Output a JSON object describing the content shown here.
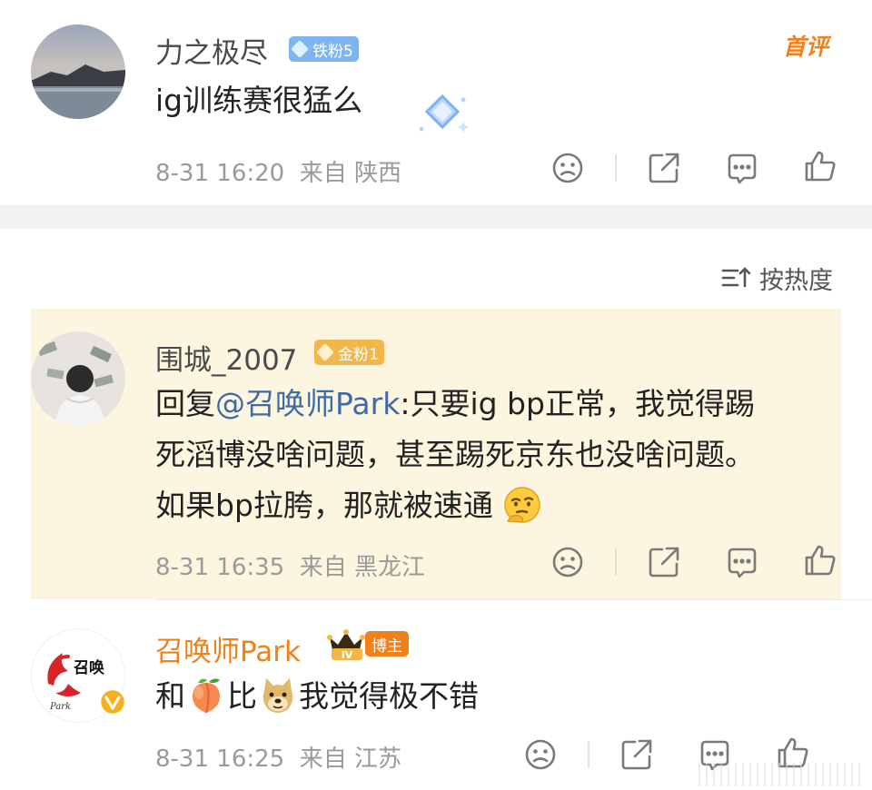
{
  "comment1": {
    "username": "力之极尽",
    "fan_badge": "铁粉5",
    "text": "ig训练赛很猛么",
    "time": "8-31 16:20",
    "location": "来自 陕西",
    "top_label": "首评"
  },
  "sort_bar": {
    "label": "按热度"
  },
  "comment2": {
    "username": "围城_2007",
    "fan_badge": "金粉1",
    "reply_prefix": "回复",
    "mention": "@召唤师Park",
    "line1": ":只要ig bp正常，我觉得踢",
    "line2": "死滔博没啥问题，甚至踢死京东也没啥问题。",
    "line3": "如果bp拉胯，那就被速通",
    "time": "8-31 16:35",
    "location": "来自 黑龙江"
  },
  "comment3": {
    "username": "召唤师Park",
    "level_badge": "IV",
    "role_badge": "博主",
    "text_a": "和",
    "text_b": "比",
    "text_c": "我觉得极不错",
    "time": "8-31 16:25",
    "location": "来自 江苏",
    "avatar_text": "召唤",
    "avatar_sub": "Park"
  },
  "colors": {
    "accent_orange": "#f0801a",
    "highlight_bg": "#fcf6e0",
    "iron_badge": "#7fb5ef",
    "gold_badge": "#f2b64a",
    "mention_blue": "#3d6ba8"
  },
  "icons": [
    "sad-face-icon",
    "share-icon",
    "comment-icon",
    "like-icon",
    "sort-icon",
    "verified-icon"
  ]
}
